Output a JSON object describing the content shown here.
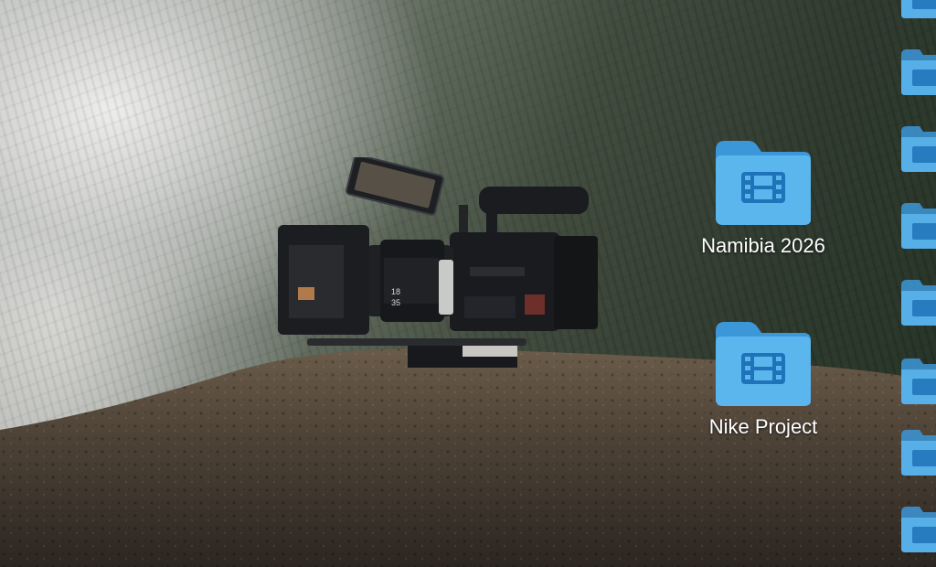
{
  "desktop": {
    "wallpaper": "cinema-camera-on-misty-mountain-ridge",
    "icons": [
      {
        "label": "Namibia 2026",
        "icon": "video-folder-icon"
      },
      {
        "label": "Nike Project",
        "icon": "video-folder-icon"
      }
    ],
    "edge_icons_count": 8,
    "colors": {
      "folder_back": "#3c97d8",
      "folder_front": "#5cb6ee",
      "folder_glyph": "#1f73b8",
      "label_text": "#ffffff"
    }
  }
}
